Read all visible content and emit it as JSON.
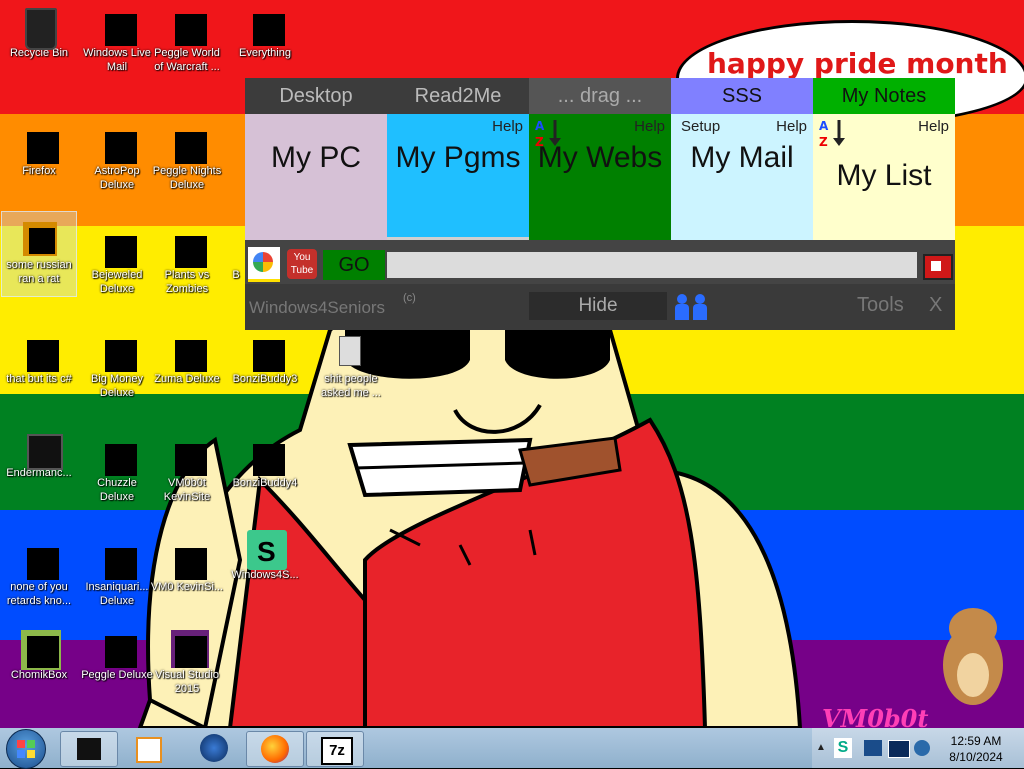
{
  "colors": {
    "red": "#f0161a",
    "orange": "#ff8c00",
    "yellow": "#ffed00",
    "green": "#008121",
    "blue": "#004cff",
    "purple": "#760188",
    "skin": "#fdf1b7",
    "shirt": "#e8232a"
  },
  "desktop": {
    "icons": [
      {
        "label": "Recycle Bin",
        "icon": "recycle-bin-icon"
      },
      {
        "label": "Windows Live Mail",
        "icon": "mail-icon"
      },
      {
        "label": "Peggle World of Warcraft ...",
        "icon": "peggle-icon"
      },
      {
        "label": "Everything",
        "icon": "everything-search-icon"
      },
      {
        "label": "Firefox",
        "icon": "firefox-icon"
      },
      {
        "label": "AstroPop Deluxe",
        "icon": "astropop-icon"
      },
      {
        "label": "Peggle Nights Deluxe",
        "icon": "peggle-nights-icon"
      },
      {
        "label": "some russian ran a rat",
        "icon": "image-icon"
      },
      {
        "label": "Bejeweled Deluxe",
        "icon": "bejeweled-icon"
      },
      {
        "label": "Plants vs Zombies",
        "icon": "plants-vs-zombies-icon"
      },
      {
        "label": "B",
        "icon": "game-icon"
      },
      {
        "label": "that but its c#",
        "icon": "folder-icon"
      },
      {
        "label": "Big Money Deluxe",
        "icon": "big-money-icon"
      },
      {
        "label": "Zuma Deluxe",
        "icon": "zuma-icon"
      },
      {
        "label": "BonziBuddy3",
        "icon": "bonzi-icon"
      },
      {
        "label": "shit people asked me ...",
        "icon": "text-file-icon"
      },
      {
        "label": "Endermanc...",
        "icon": "console-icon"
      },
      {
        "label": "Chuzzle Deluxe",
        "icon": "chuzzle-icon"
      },
      {
        "label": "VM0b0t KevinSite",
        "icon": "vm-icon"
      },
      {
        "label": "BonziBuddy4",
        "icon": "bonzi-icon"
      },
      {
        "label": "none of you retards kno...",
        "icon": "image-icon"
      },
      {
        "label": "Insaniquari... Deluxe",
        "icon": "insaniquarium-icon"
      },
      {
        "label": "VM0 KevinSi...",
        "icon": "file-icon"
      },
      {
        "label": "Windows4S...",
        "icon": "windows4seniors-icon"
      },
      {
        "label": "ChomikBox",
        "icon": "chomikbox-icon"
      },
      {
        "label": "Peggle Deluxe",
        "icon": "peggle-icon"
      },
      {
        "label": "Visual Studio 2015",
        "icon": "visual-studio-icon"
      }
    ],
    "bubble_text": "happy pride month",
    "watermark": "VM0b0t"
  },
  "w4s": {
    "tabs": [
      "Desktop",
      "Read2Me",
      "... drag ...",
      "SSS",
      "My Notes"
    ],
    "tiles": [
      {
        "title": "My PC"
      },
      {
        "title": "My Pgms",
        "help": "Help"
      },
      {
        "title": "My Webs",
        "help": "Help"
      },
      {
        "title": "My Mail",
        "help": "Help",
        "setup": "Setup"
      },
      {
        "title": "My List",
        "help": "Help"
      }
    ],
    "go": "GO",
    "search_value": "",
    "brand": "Windows4Seniors",
    "copyright": "(c)",
    "hide": "Hide",
    "tools": "Tools",
    "close": "X"
  },
  "taskbar": {
    "time": "12:59 AM",
    "date": "8/10/2024",
    "apps": [
      "black-square-app",
      "media-player-app",
      "globe-app",
      "firefox-app",
      "7zip-app"
    ],
    "app_label_7z": "7z"
  }
}
